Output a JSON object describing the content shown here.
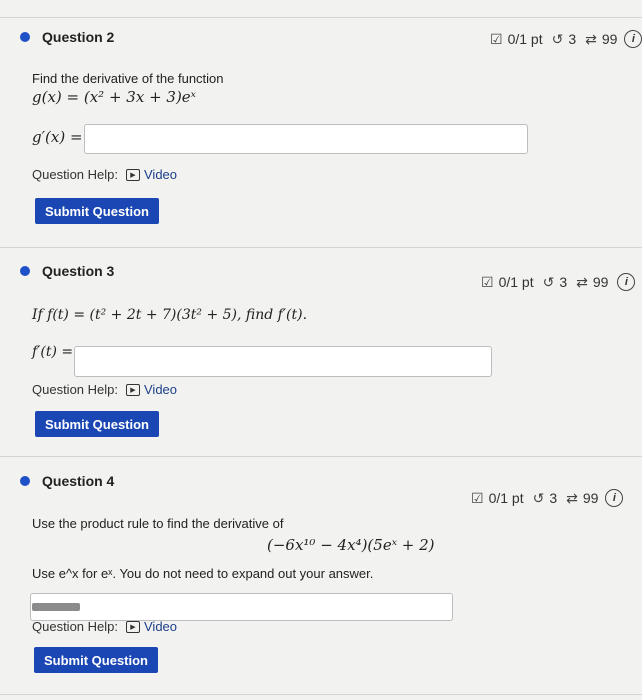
{
  "q2": {
    "title": "Question 2",
    "score": "0/1 pt",
    "retries": "3",
    "attempts": "99",
    "prompt": "Find the derivative of the function",
    "function": "g(x) = (x² + 3x + 3)eˣ",
    "answer_label": "g′(x) =",
    "answer_value": "",
    "help_label": "Question Help:",
    "video_label": "Video",
    "submit_label": "Submit Question"
  },
  "q3": {
    "title": "Question 3",
    "score": "0/1 pt",
    "retries": "3",
    "attempts": "99",
    "prompt": "If f(t) = (t² + 2t + 7)(3t² + 5), find f′(t).",
    "answer_label": "f′(t) =",
    "answer_value": "",
    "help_label": "Question Help:",
    "video_label": "Video",
    "submit_label": "Submit Question"
  },
  "q4": {
    "title": "Question 4",
    "score": "0/1 pt",
    "retries": "3",
    "attempts": "99",
    "prompt": "Use the product rule to find the derivative of",
    "expression": "(−6x¹⁰ − 4x⁴)(5eˣ + 2)",
    "hint": "Use e^x for eˣ. You do not need to expand out your answer.",
    "answer_value": "",
    "help_label": "Question Help:",
    "video_label": "Video",
    "submit_label": "Submit Question"
  },
  "icons": {
    "score": "checkbox-pencil-icon",
    "retry": "retry-icon",
    "attempts": "attempts-cycle-icon",
    "info": "info-icon",
    "play": "play-icon"
  },
  "colors": {
    "accent": "#1b47b5",
    "dot": "#1e50c8"
  }
}
